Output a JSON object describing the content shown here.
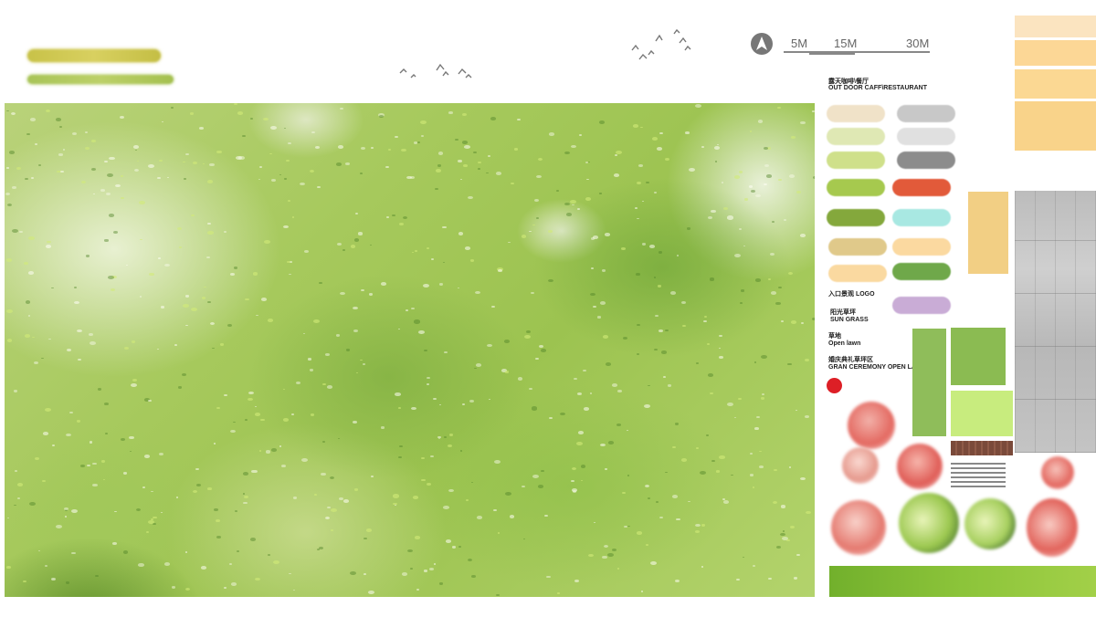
{
  "scale_bar": {
    "labels": [
      "5M",
      "15M",
      "30M"
    ]
  },
  "north_arrow": {
    "icon": "north-arrow-icon"
  },
  "legend": {
    "outdoor_cafe_cn": "露天咖啡\\餐厅",
    "outdoor_cafe_en": "OUT DOOR CAFF\\RESTAURANT",
    "entrance_logo": "入口景观 LOGO",
    "sun_grass_cn": "阳光草坪",
    "sun_grass_en": "SUN  GRASS",
    "open_lawn_cn": "草地",
    "open_lawn_en": "Open lawn",
    "ceremony_cn": "婚庆典礼草坪区",
    "ceremony_en": "GRAN CEREMONY OPEN LA",
    "marker_color": "#dd1f26"
  },
  "swatches": {
    "left": [
      "#f0e2c8",
      "#dfe8b4",
      "#cfe08a",
      "#a6c94e",
      "#84a83c",
      "#e0c98a",
      "#fad9a0"
    ],
    "right": [
      "#c8c8c8",
      "#e0e0e0",
      "#8c8c8c",
      "#e25a3a",
      "#a8e8e2",
      "#fbd9a0",
      "#6fa84a",
      "#c9acd6"
    ]
  },
  "palette_colors": {
    "texture_base": "#a6c95c",
    "sand_stripes": [
      "#fbe4c0",
      "#fcd796",
      "#fbd893",
      "#f9d38a"
    ],
    "lawn_tiles": [
      "#8fbd5a",
      "#8bbb52",
      "#c8ec7e"
    ],
    "bottom_band": "#7fba2c"
  }
}
